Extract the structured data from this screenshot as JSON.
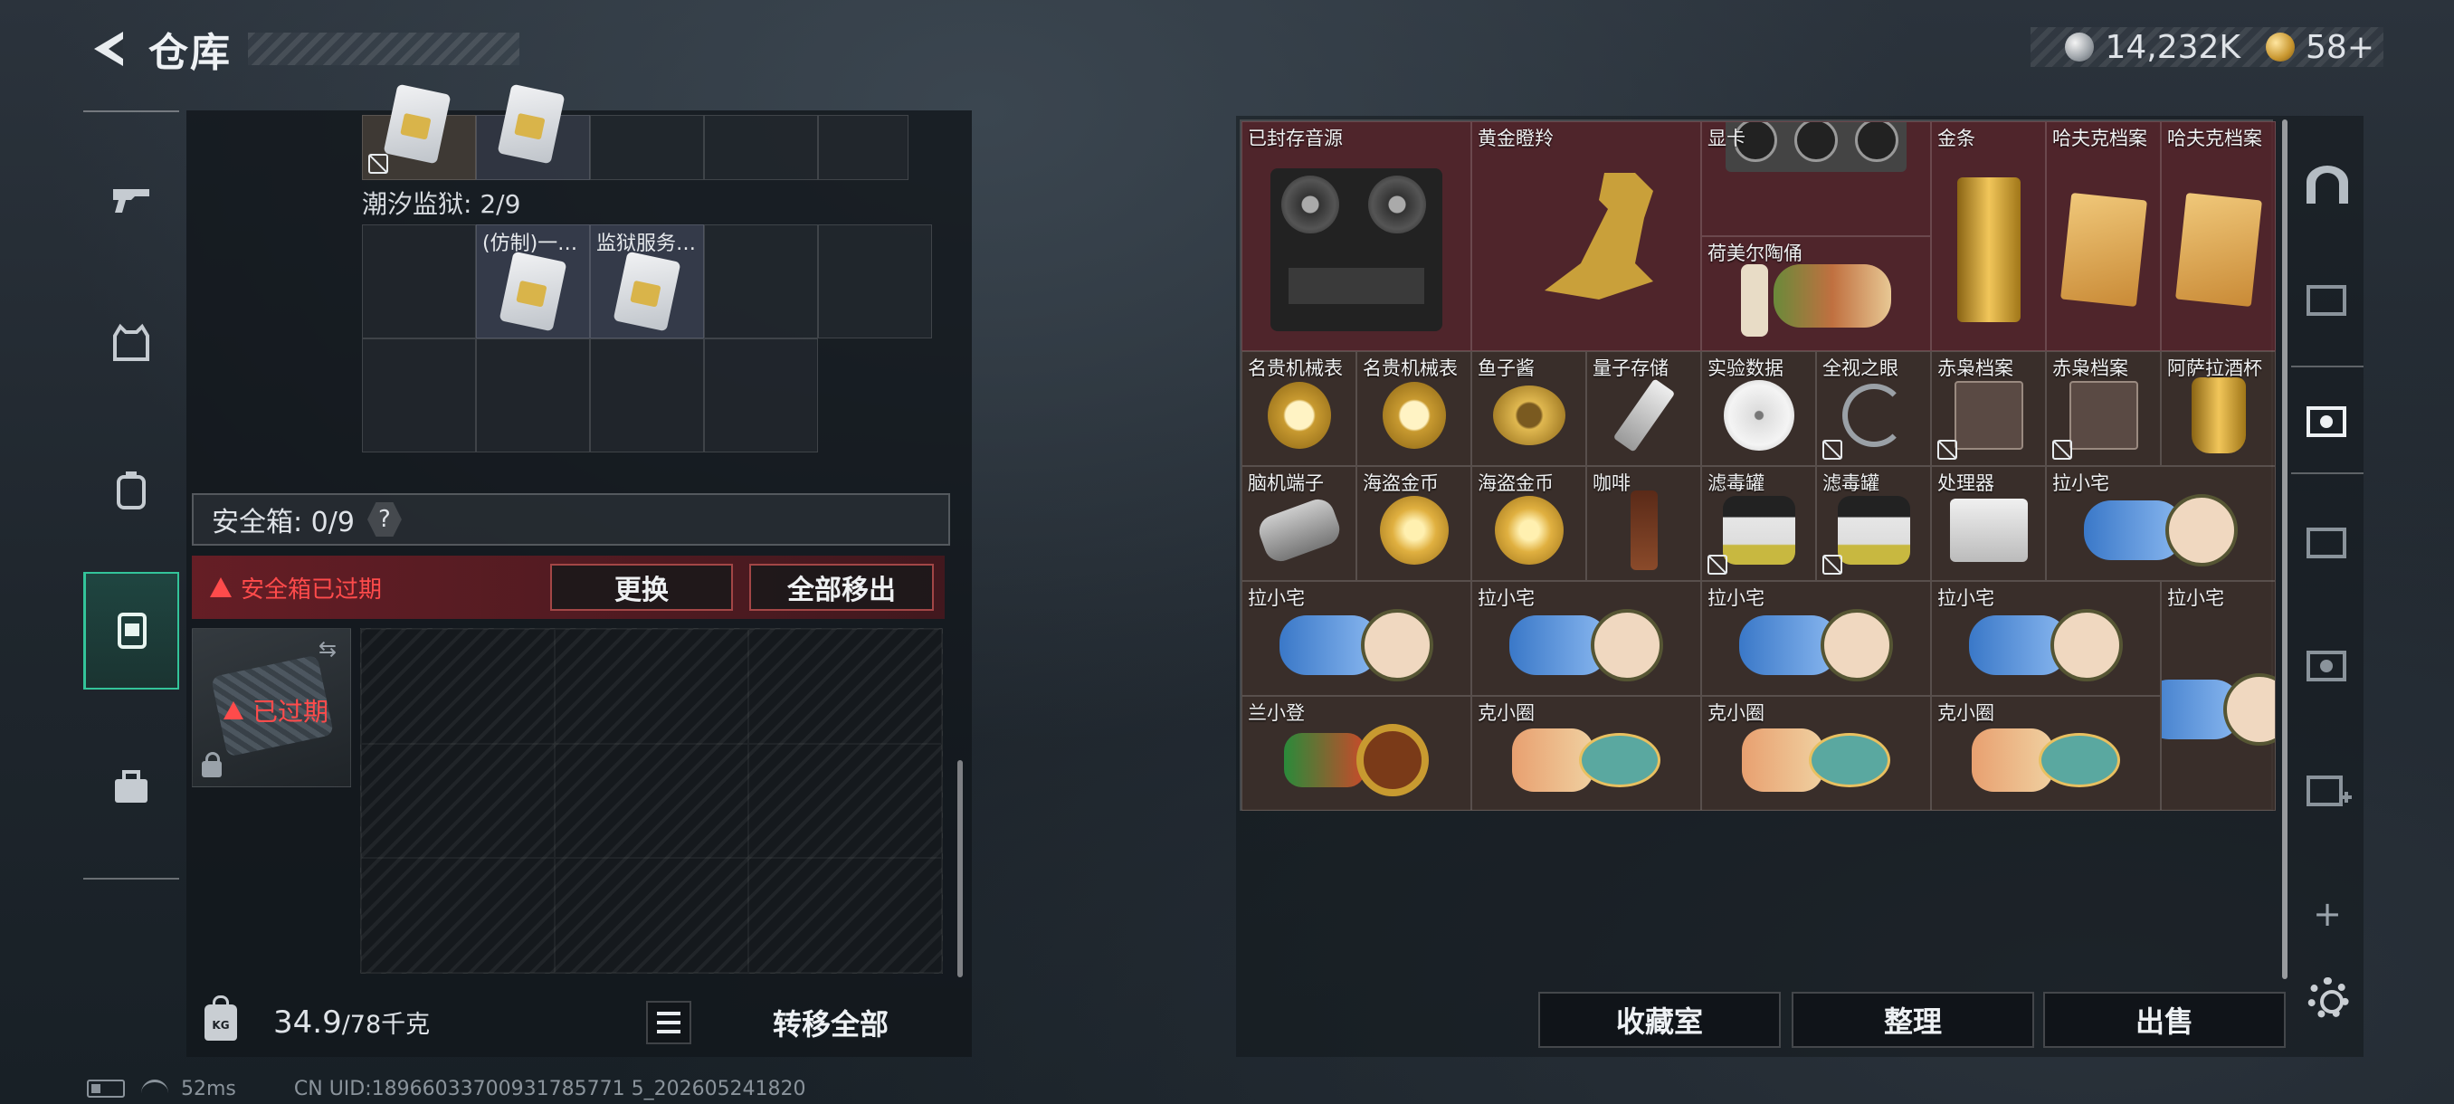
{
  "header": {
    "title": "仓库",
    "currency_silver": "14,232K",
    "currency_gold": "58+"
  },
  "left_panel": {
    "prison_section_title": "潮汐监狱: 2/9",
    "prison_items": [
      "(仿制)一…",
      "监狱服务…"
    ],
    "safe_box_label": "安全箱: 0/9",
    "safe_box_help": "?",
    "expired_warning": "安全箱已过期",
    "replace_button": "更换",
    "move_all_button": "全部移出",
    "case_status": "已过期",
    "weight_icon_text": "KG",
    "weight_current": "34.9",
    "weight_max": "/78千克",
    "transfer_all_button": "转移全部"
  },
  "stash": {
    "items": [
      {
        "label": "已封存音源",
        "icon": "reel-tape-recorder"
      },
      {
        "label": "黄金瞪羚",
        "icon": "golden-gazelle"
      },
      {
        "label": "显卡",
        "icon": "graphics-card"
      },
      {
        "label": "金条",
        "icon": "gold-bar"
      },
      {
        "label": "哈夫克档案",
        "icon": "document-folder"
      },
      {
        "label": "哈夫克档案",
        "icon": "document-folder"
      },
      {
        "label": "荷美尔陶俑",
        "icon": "ceramic-figurine"
      },
      {
        "label": "名贵机械表",
        "icon": "gold-watch"
      },
      {
        "label": "名贵机械表",
        "icon": "gold-watch"
      },
      {
        "label": "鱼子酱",
        "icon": "caviar-tin"
      },
      {
        "label": "量子存储",
        "icon": "usb-drive"
      },
      {
        "label": "实验数据",
        "icon": "disc"
      },
      {
        "label": "全视之眼",
        "icon": "eye-necklace"
      },
      {
        "label": "赤枭档案",
        "icon": "document-box"
      },
      {
        "label": "赤枭档案",
        "icon": "document-box"
      },
      {
        "label": "阿萨拉酒杯",
        "icon": "golden-cup"
      },
      {
        "label": "脑机端子",
        "icon": "neural-connector"
      },
      {
        "label": "海盗金币",
        "icon": "gold-coin"
      },
      {
        "label": "海盗金币",
        "icon": "gold-coin"
      },
      {
        "label": "咖啡",
        "icon": "coffee-bottle"
      },
      {
        "label": "滤毒罐",
        "icon": "filter-canister"
      },
      {
        "label": "滤毒罐",
        "icon": "filter-canister"
      },
      {
        "label": "处理器",
        "icon": "processor-device"
      },
      {
        "label": "拉小宅",
        "icon": "plush-doll"
      },
      {
        "label": "拉小宅",
        "icon": "plush-doll"
      },
      {
        "label": "拉小宅",
        "icon": "plush-doll"
      },
      {
        "label": "拉小宅",
        "icon": "plush-doll"
      },
      {
        "label": "拉小宅",
        "icon": "plush-doll"
      },
      {
        "label": "拉小宅",
        "icon": "plush-doll"
      },
      {
        "label": "兰小登",
        "icon": "sombrero-doll"
      },
      {
        "label": "克小圈",
        "icon": "hat-doll"
      },
      {
        "label": "克小圈",
        "icon": "hat-doll"
      },
      {
        "label": "克小圈",
        "icon": "hat-doll"
      }
    ],
    "collection_button": "收藏室",
    "organize_button": "整理",
    "sell_button": "出售",
    "add_tab": "+"
  },
  "status": {
    "ping": "52ms",
    "uid": "CN UID:18966033700931785771 5_202605241820"
  },
  "colors": {
    "accent_green": "#33c49a",
    "warning_red": "#ff4b4b",
    "rare_maroon": "#56262c"
  }
}
